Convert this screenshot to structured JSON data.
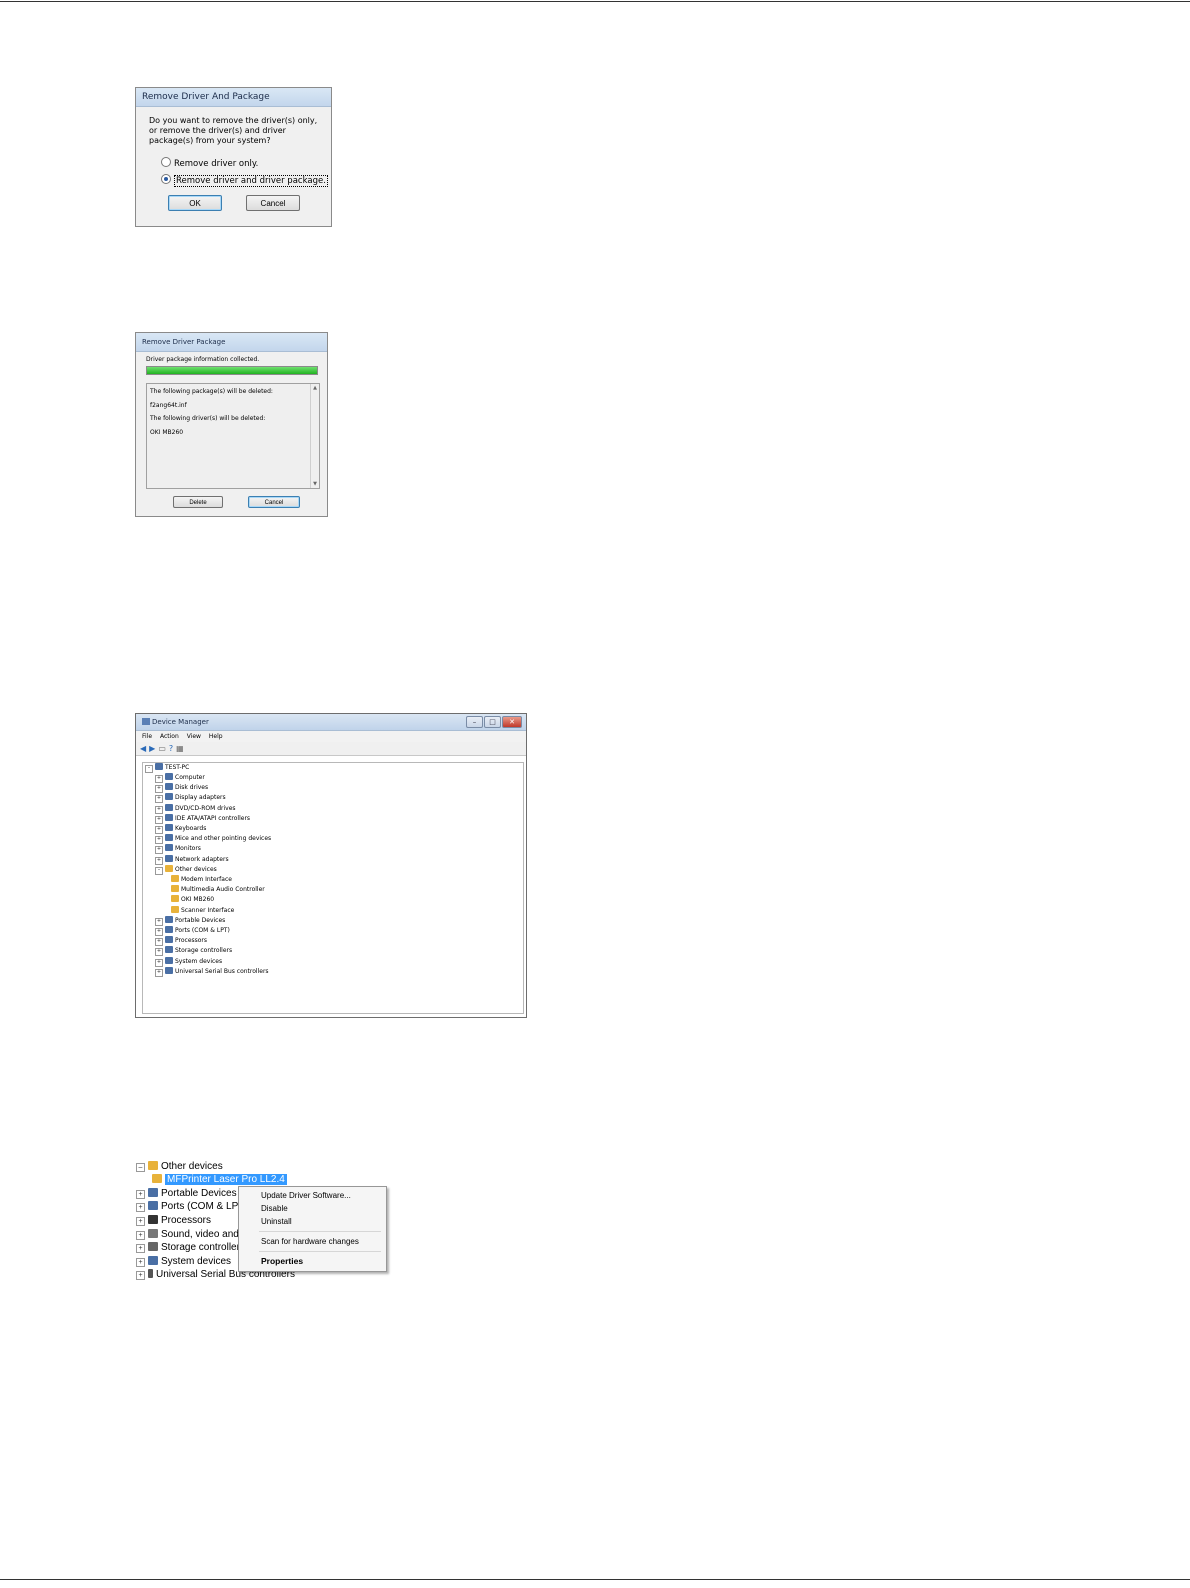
{
  "dialog1": {
    "title": "Remove Driver And Package",
    "question": "Do you want to remove the driver(s) only, or remove the driver(s) and driver package(s) from your system?",
    "option1": "Remove driver only.",
    "option2": "Remove driver and driver package.",
    "ok": "OK",
    "cancel": "Cancel"
  },
  "dialog2": {
    "title": "Remove Driver Package",
    "status": "Driver package information collected.",
    "progress": 1.0,
    "lines": [
      "The following package(s) will be deleted:",
      "f2ang64t.inf",
      "The following driver(s) will be deleted:",
      "OKI MB260"
    ],
    "delete": "Delete",
    "cancel": "Cancel"
  },
  "device_manager": {
    "title": "Device Manager",
    "menus": [
      "File",
      "Action",
      "View",
      "Help"
    ],
    "root": "TEST-PC",
    "nodes": [
      "Computer",
      "Disk drives",
      "Display adapters",
      "DVD/CD-ROM drives",
      "IDE ATA/ATAPI controllers",
      "Keyboards",
      "Mice and other pointing devices",
      "Monitors",
      "Network adapters",
      "Other devices",
      "Modem Interface",
      "Multimedia Audio Controller",
      "OKI MB260",
      "Scanner Interface",
      "Portable Devices",
      "Ports (COM & LPT)",
      "Processors",
      "Storage controllers",
      "System devices",
      "Universal Serial Bus controllers"
    ]
  },
  "context_tree": {
    "rows": [
      "Other devices",
      "MFPrinter Laser Pro LL2.4",
      "Portable Devices",
      "Ports (COM & LPT",
      "Processors",
      "Sound, video and g",
      "Storage controllers",
      "System devices",
      "Universal Serial Bus controllers"
    ],
    "menu": {
      "update": "Update Driver Software...",
      "disable": "Disable",
      "uninstall": "Uninstall",
      "scan": "Scan for hardware changes",
      "properties": "Properties"
    }
  }
}
